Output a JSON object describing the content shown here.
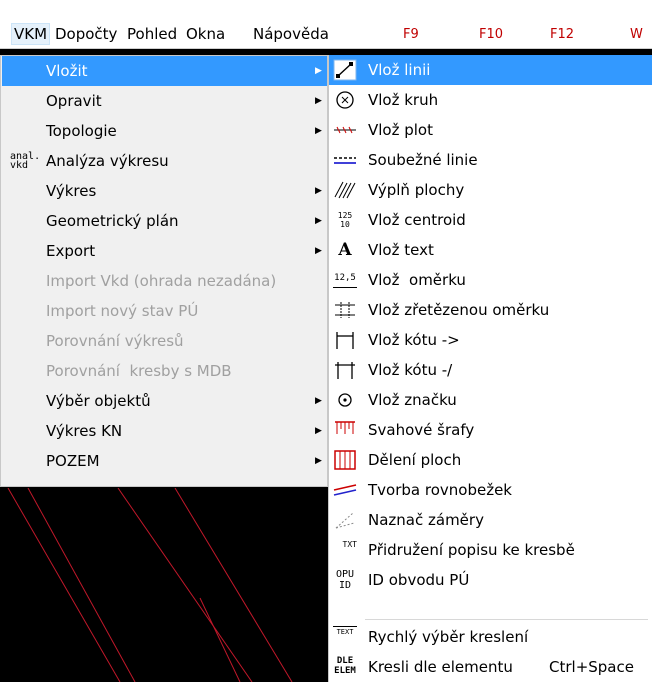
{
  "menubar": {
    "items": [
      "VKM",
      "Dopočty",
      "Pohled",
      "Okna",
      "Nápověda"
    ],
    "fkeys": [
      "F9",
      "F10",
      "F12",
      "W"
    ]
  },
  "menu_vkm": {
    "items": [
      {
        "label": "Vložit",
        "icon_text": ""
      },
      {
        "label": "Opravit",
        "icon_text": ""
      },
      {
        "label": "Topologie",
        "icon_text": ""
      },
      {
        "label": "Analýza výkresu",
        "icon_text": "anal.\nvkd"
      },
      {
        "label": "Výkres",
        "icon_text": ""
      },
      {
        "label": "Geometrický plán",
        "icon_text": ""
      },
      {
        "label": "Export",
        "icon_text": ""
      },
      {
        "label": "Import Vkd (ohrada nezadána)",
        "icon_text": ""
      },
      {
        "label": "Import nový stav PÚ",
        "icon_text": ""
      },
      {
        "label": "Porovnání výkresů",
        "icon_text": ""
      },
      {
        "label": "Porovnání  kresby s MDB",
        "icon_text": ""
      },
      {
        "label": "Výběr objektů",
        "icon_text": ""
      },
      {
        "label": "Výkres KN",
        "icon_text": ""
      },
      {
        "label": "POZEM",
        "icon_text": ""
      }
    ]
  },
  "menu_vlozit": {
    "items": [
      {
        "label": "Vlož linii",
        "icon": "line-icon"
      },
      {
        "label": "Vlož kruh",
        "icon": "circle-icon"
      },
      {
        "label": "Vlož plot",
        "icon": "fence-icon"
      },
      {
        "label": "Soubežné linie",
        "icon": "parallel-lines-icon"
      },
      {
        "label": "Výplň plochy",
        "icon": "hatch-fill-icon"
      },
      {
        "label": "Vlož centroid",
        "icon": "centroid-icon",
        "icon_text": "125\n10"
      },
      {
        "label": "Vlož text",
        "icon": "text-icon",
        "icon_text": "A"
      },
      {
        "label": "Vlož  oměrku",
        "icon": "measure-icon",
        "icon_text": "12,5"
      },
      {
        "label": "Vlož zřetězenou oměrku",
        "icon": "chain-measure-icon"
      },
      {
        "label": "Vlož kótu ->",
        "icon": "dimension-icon"
      },
      {
        "label": "Vlož kótu -/",
        "icon": "dimension-slant-icon"
      },
      {
        "label": "Vlož značku",
        "icon": "marker-icon"
      },
      {
        "label": "Svahové šrafy",
        "icon": "slope-hatch-icon"
      },
      {
        "label": "Dělení ploch",
        "icon": "area-division-icon"
      },
      {
        "label": "Tvorba rovnobežek",
        "icon": "parallels-icon"
      },
      {
        "label": "Naznač záměry",
        "icon": "sight-lines-icon"
      },
      {
        "label": "Přidružení popisu ke kresbě",
        "icon": "attach-label-icon",
        "icon_text": "TXT"
      },
      {
        "label": "ID obvodu PÚ",
        "icon": "perimeter-id-icon",
        "icon_text": "OPU\nID"
      },
      {
        "label": "Rychlý výběr kreslení",
        "icon": "quick-select-icon",
        "icon_text": "TEXT"
      },
      {
        "label": "Kresli dle elementu",
        "icon": "draw-by-element-icon",
        "icon_text": "DLE\nELEM",
        "shortcut": "Ctrl+Space"
      }
    ]
  },
  "colors": {
    "highlight": "#3399ff",
    "disabled": "#a0a0a0",
    "fkey": "#c00000",
    "canvas_line": "#c0182a"
  }
}
